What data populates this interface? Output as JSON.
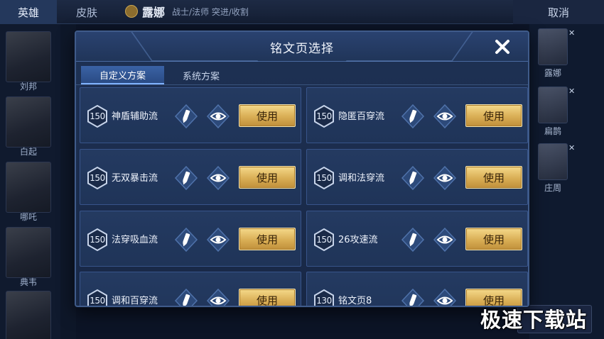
{
  "topbar": {
    "tabs": [
      {
        "label": "英雄",
        "active": true
      },
      {
        "label": "皮肤",
        "active": false
      }
    ],
    "hero_name": "露娜",
    "hero_roles": "战士/法师 突进/收割",
    "cancel_label": "取消"
  },
  "left_heroes": [
    {
      "label": "刘邦"
    },
    {
      "label": "白起"
    },
    {
      "label": "哪吒"
    },
    {
      "label": "典韦"
    },
    {
      "label": ""
    }
  ],
  "right_heroes": [
    {
      "label": "露娜"
    },
    {
      "label": "扁鹊"
    },
    {
      "label": "庄周"
    }
  ],
  "dialog": {
    "title": "铭文页选择",
    "close_icon": "close-icon",
    "tabs": [
      {
        "label": "自定义方案",
        "active": true
      },
      {
        "label": "系统方案",
        "active": false
      }
    ],
    "plans": [
      {
        "level": "150",
        "name": "神盾辅助流",
        "use_label": "使用"
      },
      {
        "level": "150",
        "name": "隐匿百穿流",
        "use_label": "使用"
      },
      {
        "level": "150",
        "name": "无双暴击流",
        "use_label": "使用"
      },
      {
        "level": "150",
        "name": "调和法穿流",
        "use_label": "使用"
      },
      {
        "level": "150",
        "name": "法穿吸血流",
        "use_label": "使用"
      },
      {
        "level": "150",
        "name": "26攻速流",
        "use_label": "使用"
      },
      {
        "level": "150",
        "name": "调和百穿流",
        "use_label": "使用"
      },
      {
        "level": "130",
        "name": "铭文页8",
        "use_label": "使用"
      }
    ]
  },
  "watermark": "极速下载站",
  "colors": {
    "panel": "#1e3154",
    "card": "#243a61",
    "gold": "#d9ae55",
    "accent_blue": "#3a62a5"
  }
}
